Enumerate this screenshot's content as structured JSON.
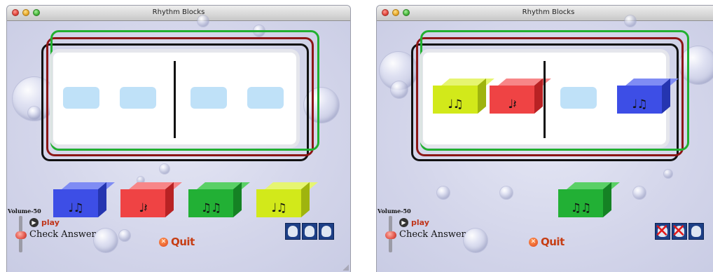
{
  "windows": [
    {
      "title": "Rhythm Blocks",
      "staff_slots": [
        "empty",
        "empty",
        "empty",
        "empty"
      ],
      "blocks": [
        {
          "color": "blue",
          "notes": "♩♫"
        },
        {
          "color": "red",
          "notes": "♩𝄽"
        },
        {
          "color": "green",
          "notes": "♫♫"
        },
        {
          "color": "yellow",
          "notes": "♩♫"
        }
      ],
      "volume_label": "Volume-50",
      "play_label": "play",
      "check_label": "Check Answer",
      "quit_label": "Quit",
      "attempts": [
        "available",
        "available",
        "available"
      ]
    },
    {
      "title": "Rhythm Blocks",
      "staff_slots": [
        "yellow",
        "red",
        "empty",
        "blue"
      ],
      "blocks": [
        {
          "color": "green",
          "notes": "♫♫"
        }
      ],
      "volume_label": "Volume-50",
      "play_label": "play",
      "check_label": "Check Answer",
      "quit_label": "Quit",
      "attempts": [
        "used",
        "used",
        "available"
      ]
    }
  ],
  "colors": {
    "blue": "#3d4ee6",
    "red": "#ef4344",
    "green": "#22b035",
    "yellow": "#d2e91a",
    "slot": "#bfe1f8",
    "play": "#c03419",
    "quit": "#c63d13"
  },
  "icons": {
    "play": "play-circle-icon",
    "quit": "quit-x-icon",
    "attempt": "face-icon",
    "attempt_used": "crossed-face-icon"
  }
}
